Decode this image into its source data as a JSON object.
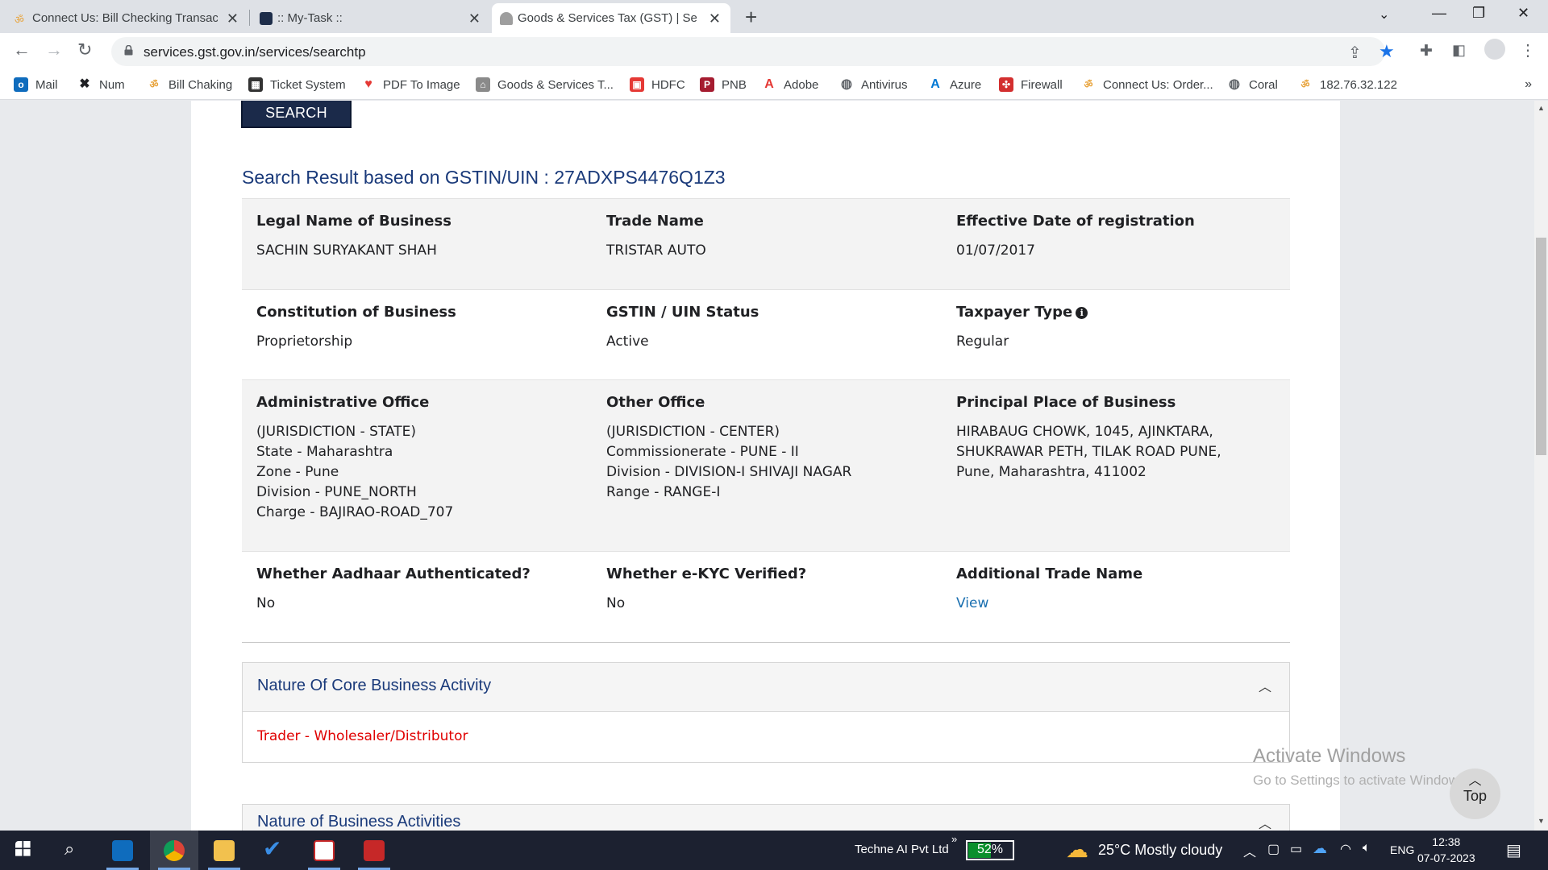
{
  "browser": {
    "tabs": [
      {
        "title": "Connect Us: Bill Checking Transac",
        "icon": "gst-favicon"
      },
      {
        "title": ":: My-Task ::",
        "icon": "task-favicon"
      },
      {
        "title": "Goods & Services Tax (GST) | Serv",
        "icon": "gst-emblem-favicon",
        "active": true
      }
    ],
    "url": "services.gst.gov.in/services/searchtp",
    "bookmarks": [
      {
        "label": "Mail",
        "icon": "outlook-icon",
        "color": "#0f6cbd"
      },
      {
        "label": "Num",
        "icon": "num-icon",
        "color": "#202124"
      },
      {
        "label": "Bill Chaking",
        "icon": "bill-icon",
        "color": "#e8a33b"
      },
      {
        "label": "Ticket System",
        "icon": "ticket-icon",
        "color": "#333333"
      },
      {
        "label": "PDF To Image",
        "icon": "pdf-icon",
        "color": "#e53935"
      },
      {
        "label": "Goods & Services T...",
        "icon": "gst-emblem-icon",
        "color": "#7a7a7a"
      },
      {
        "label": "HDFC",
        "icon": "hdfc-icon",
        "color": "#e53935"
      },
      {
        "label": "PNB",
        "icon": "pnb-icon",
        "color": "#a51c30"
      },
      {
        "label": "Adobe",
        "icon": "adobe-icon",
        "color": "#e53935"
      },
      {
        "label": "Antivirus",
        "icon": "globe-icon",
        "color": "#5f6368"
      },
      {
        "label": "Azure",
        "icon": "azure-icon",
        "color": "#0078d4"
      },
      {
        "label": "Firewall",
        "icon": "firewall-icon",
        "color": "#d32f2f"
      },
      {
        "label": "Connect Us: Order...",
        "icon": "connect-icon",
        "color": "#e8a33b"
      },
      {
        "label": "Coral",
        "icon": "globe-icon",
        "color": "#5f6368"
      },
      {
        "label": "182.76.32.122",
        "icon": "server-icon",
        "color": "#e8a33b"
      }
    ],
    "more_bookmarks": "»"
  },
  "page": {
    "search_button": "SEARCH",
    "result_title": "Search Result based on GSTIN/UIN : 27ADXPS4476Q1Z3",
    "rows": [
      {
        "shaded": true,
        "cells": [
          {
            "label": "Legal Name of Business",
            "value": "SACHIN SURYAKANT SHAH"
          },
          {
            "label": "Trade Name",
            "value": "TRISTAR AUTO"
          },
          {
            "label": "Effective Date of registration",
            "value": "01/07/2017"
          }
        ]
      },
      {
        "shaded": false,
        "cells": [
          {
            "label": "Constitution of Business",
            "value": "Proprietorship"
          },
          {
            "label": "GSTIN / UIN Status",
            "value": "Active"
          },
          {
            "label": "Taxpayer Type",
            "value": "Regular",
            "info_icon": true
          }
        ]
      },
      {
        "shaded": true,
        "cells": [
          {
            "label": "Administrative Office",
            "value": "(JURISDICTION - STATE)\nState - Maharashtra\nZone - Pune\nDivision - PUNE_NORTH\nCharge - BAJIRAO-ROAD_707"
          },
          {
            "label": "Other Office",
            "value": "(JURISDICTION - CENTER)\nCommissionerate - PUNE - II\nDivision - DIVISION-I SHIVAJI NAGAR\nRange - RANGE-I"
          },
          {
            "label": "Principal Place of Business",
            "value": "HIRABAUG CHOWK, 1045, AJINKTARA,\nSHUKRAWAR PETH, TILAK ROAD PUNE,\nPune, Maharashtra, 411002"
          }
        ]
      },
      {
        "shaded": false,
        "cells": [
          {
            "label": "Whether Aadhaar Authenticated?",
            "value": "No"
          },
          {
            "label": "Whether e-KYC Verified?",
            "value": "No"
          },
          {
            "label": "Additional Trade Name",
            "value": "View",
            "link": true
          }
        ]
      }
    ],
    "panels": [
      {
        "title": "Nature Of Core Business Activity",
        "body": "Trader - Wholesaler/Distributor"
      },
      {
        "title": "Nature of Business Activities",
        "body": ""
      }
    ],
    "watermark_line1": "Activate Windows",
    "watermark_line2": "Go to Settings to activate Windows.",
    "top_button": "Top"
  },
  "taskbar": {
    "company": "Techne AI Pvt Ltd",
    "battery": "52%",
    "battery_level": 0.52,
    "weather": "25°C  Mostly cloudy",
    "language": "ENG",
    "time": "12:38",
    "date": "07-07-2023"
  }
}
